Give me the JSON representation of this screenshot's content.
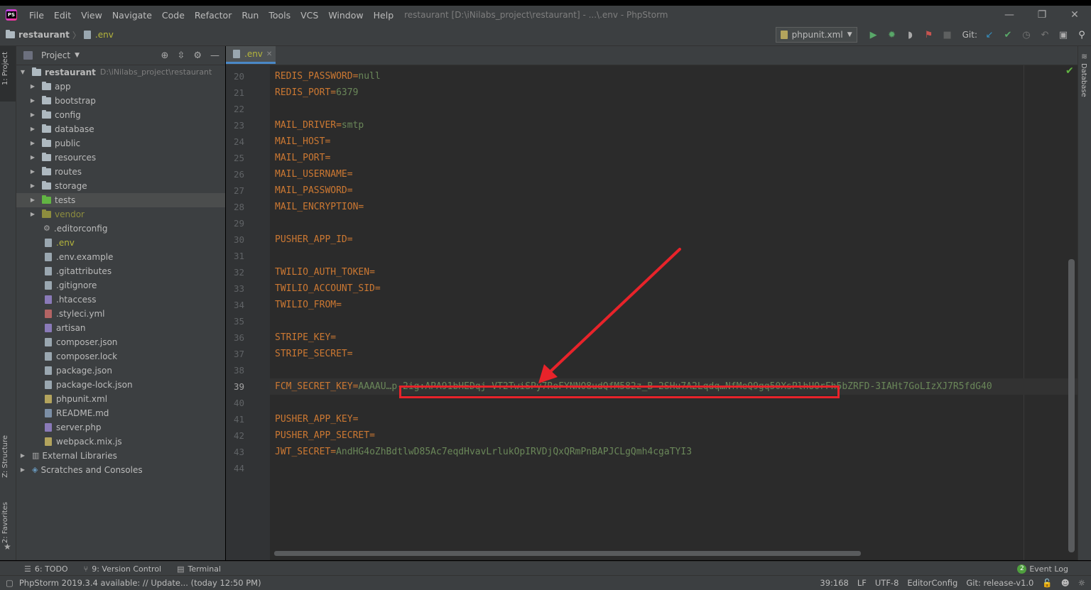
{
  "window": {
    "title": "restaurant [D:\\iNilabs_project\\restaurant] - ...\\.env - PhpStorm",
    "controls": {
      "minimize": "—",
      "restore": "❐",
      "close": "✕"
    }
  },
  "menu": [
    "File",
    "Edit",
    "View",
    "Navigate",
    "Code",
    "Refactor",
    "Run",
    "Tools",
    "VCS",
    "Window",
    "Help"
  ],
  "breadcrumb": {
    "project": "restaurant",
    "file": ".env"
  },
  "toolbar": {
    "run_config": "phpunit.xml",
    "git_label": "Git:"
  },
  "left_tabs": {
    "project": "1: Project",
    "structure": "Z: Structure",
    "favorites": "2: Favorites"
  },
  "right_tabs": {
    "database": "Database"
  },
  "project_panel": {
    "title": "Project",
    "root": {
      "name": "restaurant",
      "path": "D:\\iNilabs_project\\restaurant"
    },
    "folders": [
      "app",
      "bootstrap",
      "config",
      "database",
      "public",
      "resources",
      "routes",
      "storage",
      "tests",
      "vendor"
    ],
    "files": [
      ".editorconfig",
      ".env",
      ".env.example",
      ".gitattributes",
      ".gitignore",
      ".htaccess",
      ".styleci.yml",
      "artisan",
      "composer.json",
      "composer.lock",
      "package.json",
      "package-lock.json",
      "phpunit.xml",
      "README.md",
      "server.php",
      "webpack.mix.js"
    ],
    "external": "External Libraries",
    "scratches": "Scratches and Consoles"
  },
  "editor": {
    "tab": ".env",
    "lines": [
      {
        "num": "20",
        "key": "REDIS_PASSWORD",
        "eq": "=",
        "value": "null"
      },
      {
        "num": "21",
        "key": "REDIS_PORT",
        "eq": "=",
        "value": "6379"
      },
      {
        "num": "22",
        "key": "",
        "eq": "",
        "value": ""
      },
      {
        "num": "23",
        "key": "MAIL_DRIVER",
        "eq": "=",
        "value": "smtp"
      },
      {
        "num": "24",
        "key": "MAIL_HOST",
        "eq": "=",
        "value": ""
      },
      {
        "num": "25",
        "key": "MAIL_PORT",
        "eq": "=",
        "value": ""
      },
      {
        "num": "26",
        "key": "MAIL_USERNAME",
        "eq": "=",
        "value": ""
      },
      {
        "num": "27",
        "key": "MAIL_PASSWORD",
        "eq": "=",
        "value": ""
      },
      {
        "num": "28",
        "key": "MAIL_ENCRYPTION",
        "eq": "=",
        "value": ""
      },
      {
        "num": "29",
        "key": "",
        "eq": "",
        "value": ""
      },
      {
        "num": "30",
        "key": "PUSHER_APP_ID",
        "eq": "=",
        "value": ""
      },
      {
        "num": "31",
        "key": "",
        "eq": "",
        "value": ""
      },
      {
        "num": "32",
        "key": "TWILIO_AUTH_TOKEN",
        "eq": "=",
        "value": ""
      },
      {
        "num": "33",
        "key": "TWILIO_ACCOUNT_SID",
        "eq": "=",
        "value": ""
      },
      {
        "num": "34",
        "key": "TWILIO_FROM",
        "eq": "=",
        "value": ""
      },
      {
        "num": "35",
        "key": "",
        "eq": "",
        "value": ""
      },
      {
        "num": "36",
        "key": "STRIPE_KEY",
        "eq": "=",
        "value": ""
      },
      {
        "num": "37",
        "key": "STRIPE_SECRET",
        "eq": "=",
        "value": ""
      },
      {
        "num": "38",
        "key": "",
        "eq": "",
        "value": ""
      },
      {
        "num": "39",
        "key": "FCM_SECRET_KEY",
        "eq": "=",
        "value": "AAAAU…p-2ig:APA91bHEDqj-VT2TwiSPy7RoFYNNO8udQfM582z_B-2SHu7A2Lqdq…NfMeQ9gq50XsPlhUOrFh5bZRFD-3IAHt7GoLIzXJ7R5fdG40"
      },
      {
        "num": "40",
        "key": "",
        "eq": "",
        "value": ""
      },
      {
        "num": "41",
        "key": "PUSHER_APP_KEY",
        "eq": "=",
        "value": ""
      },
      {
        "num": "42",
        "key": "PUSHER_APP_SECRET",
        "eq": "=",
        "value": ""
      },
      {
        "num": "43",
        "key": "JWT_SECRET",
        "eq": "=",
        "value": "AndHG4oZhBdtlwD85Ac7eqdHvavLrlukOpIRVDjQxQRmPnBAPJCLgQmh4cgaTYI3"
      },
      {
        "num": "44",
        "key": "",
        "eq": "",
        "value": ""
      }
    ]
  },
  "bottom_tools": {
    "todo": "6: TODO",
    "vcs": "9: Version Control",
    "terminal": "Terminal",
    "event_log": "Event Log",
    "event_count": "2"
  },
  "statusbar": {
    "message": "PhpStorm 2019.3.4 available: // Update... (today 12:50 PM)",
    "position": "39:168",
    "line_sep": "LF",
    "encoding": "UTF-8",
    "editorconfig": "EditorConfig",
    "git_branch": "Git: release-v1.0"
  },
  "colors": {
    "key": "#cc7832",
    "value": "#6a8759",
    "annotation": "#e8232a",
    "accent": "#4a88c7"
  }
}
